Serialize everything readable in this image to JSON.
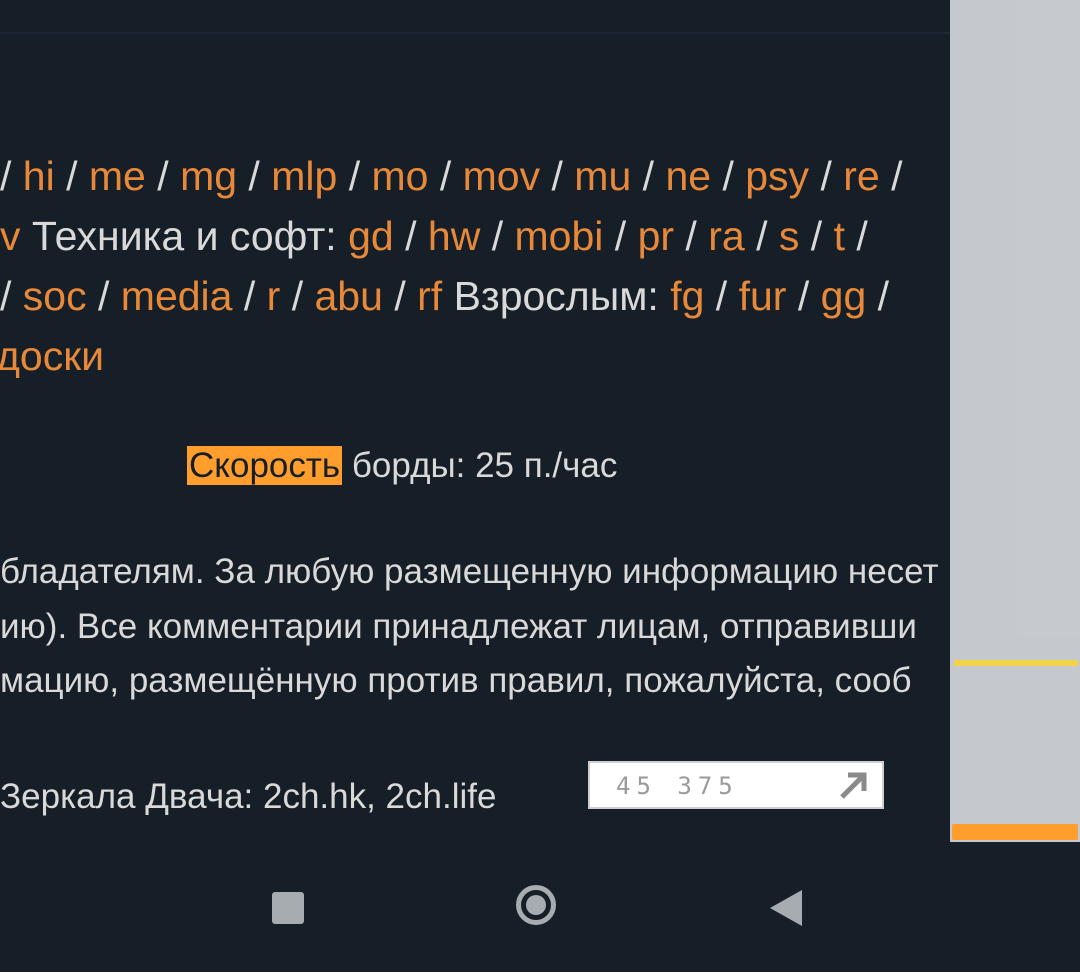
{
  "boards_row1": [
    "hi",
    "me",
    "mg",
    "mlp",
    "mo",
    "mov",
    "mu",
    "ne",
    "psy",
    "re"
  ],
  "boards_row2": {
    "lead": "v",
    "label": "Техника и софт:",
    "items": [
      "gd",
      "hw",
      "mobi",
      "pr",
      "ra",
      "s",
      "t"
    ]
  },
  "boards_row3": {
    "items": [
      "soc",
      "media",
      "r",
      "abu",
      "rf"
    ],
    "label": "Взрослым:",
    "adult": [
      "fg",
      "fur",
      "gg"
    ]
  },
  "boards_row4": "доски",
  "speed": {
    "highlight": "Скорость",
    "text": "борды: 25 п./час"
  },
  "disclaimer": {
    "line1": "бладателям. За любую размещенную информацию несет",
    "line2": "ию). Все комментарии принадлежат лицам, отправивши",
    "line3": "мацию, размещённую против правил, пожалуйста, сооб"
  },
  "mirrors": "Зеркала Двача: 2ch.hk, 2ch.life",
  "counter": {
    "value": "45 375"
  }
}
